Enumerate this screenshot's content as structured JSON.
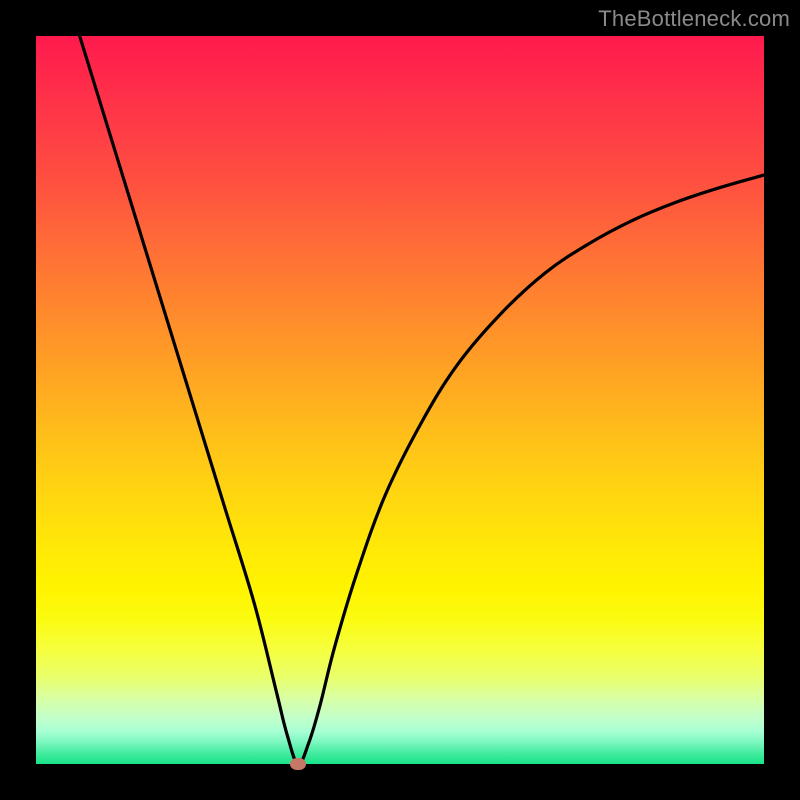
{
  "watermark": "TheBottleneck.com",
  "colors": {
    "frame": "#000000",
    "curve": "#000000",
    "dot": "#c77766",
    "watermark": "#8a8a8a"
  },
  "chart_data": {
    "type": "line",
    "title": "",
    "xlabel": "",
    "ylabel": "",
    "xlim": [
      0,
      100
    ],
    "ylim": [
      0,
      100
    ],
    "grid": false,
    "legend": false,
    "min_point": {
      "x": 36,
      "y": 0
    },
    "series": [
      {
        "name": "bottleneck-curve",
        "x": [
          6,
          10,
          14,
          18,
          22,
          26,
          30,
          33,
          34.5,
          36,
          37.5,
          39,
          41,
          44,
          48,
          53,
          58,
          64,
          70,
          76,
          82,
          88,
          94,
          100
        ],
        "values": [
          100,
          87,
          74,
          61,
          48,
          35,
          22,
          10,
          4,
          0,
          3,
          8,
          16,
          26,
          37,
          47,
          55,
          62,
          67.5,
          71.5,
          74.7,
          77.2,
          79.2,
          80.9
        ]
      }
    ]
  }
}
